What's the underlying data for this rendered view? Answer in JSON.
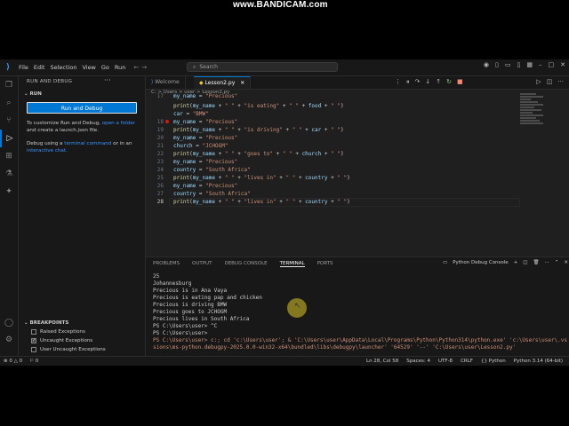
{
  "watermark": "www.BANDICAM.com",
  "menu": [
    "File",
    "Edit",
    "Selection",
    "View",
    "Go",
    "Run"
  ],
  "search": {
    "placeholder": "Search"
  },
  "tabs": [
    {
      "label": "Welcome"
    },
    {
      "label": "Lesson2.py"
    }
  ],
  "breadcrumb": "C: > Users > user > Lesson2.py",
  "sidebar": {
    "title": "RUN AND DEBUG",
    "section": "RUN",
    "run_button": "Run and Debug",
    "customize_prefix": "To customize Run and Debug,",
    "customize_link": "open a folder",
    "customize_suffix": "and create a launch.json file.",
    "terminal_prefix": "Debug using a",
    "terminal_link": "terminal command",
    "terminal_mid": "or in an",
    "chat_link": "interactive chat.",
    "breakpoints_title": "BREAKPOINTS",
    "breakpoints": [
      {
        "label": "Raised Exceptions",
        "checked": false
      },
      {
        "label": "Uncaught Exceptions",
        "checked": true
      },
      {
        "label": "User Uncaught Exceptions",
        "checked": false
      }
    ]
  },
  "code_lines": [
    {
      "n": "17",
      "text": "my_name = \"Precious\"",
      "partial": true
    },
    {
      "n": "",
      "text": "print(my_name + \" \" + \"is eating\" + \" \" + food + \" \")"
    },
    {
      "n": "",
      "text": "car = \"BMW\""
    },
    {
      "n": "18",
      "text": "my_name = \"Precious\"",
      "bp": true
    },
    {
      "n": "19",
      "text": "print(my_name + \" \" + \"is driving\" + \" \" + car + \" \")"
    },
    {
      "n": "20",
      "text": "my_name = \"Precious\""
    },
    {
      "n": "21",
      "text": "church = \"JCHOGM\""
    },
    {
      "n": "22",
      "text": "print(my_name + \" \" + \"goes to\" + \" \" + church + \" \")"
    },
    {
      "n": "23",
      "text": "my_name = \"Precious\""
    },
    {
      "n": "24",
      "text": "country = \"South Africa\""
    },
    {
      "n": "25",
      "text": "print(my_name + \" \" + \"lives in\" + \" \" + country + \" \")"
    },
    {
      "n": "26",
      "text": "my_name = \"Precious\""
    },
    {
      "n": "27",
      "text": "country = \"South Africa\""
    },
    {
      "n": "28",
      "text": "print(my_name + \" \" + \"lives in\" + \" \" + country + \" \")",
      "current": true
    }
  ],
  "panel": {
    "tabs": [
      "PROBLEMS",
      "OUTPUT",
      "DEBUG CONSOLE",
      "TERMINAL",
      "PORTS"
    ],
    "active_tab": "TERMINAL",
    "session": "Python Debug Console"
  },
  "terminal_lines": [
    "25",
    "Johannesburg",
    "Precious is in Ana Vaya",
    "Precious is eating pap and chicken",
    "Precious is driving BMW",
    "Precious goes to JCHOGM",
    "Precious lives in South Africa",
    "PS C:\\Users\\user> ^C",
    "PS C:\\Users\\user>",
    "PS C:\\Users\\user> c:; cd 'c:\\Users\\user'; & 'C:\\Users\\user\\AppData\\Local\\Programs\\Python\\Python314\\python.exe' 'c:\\Users\\user\\.vscode\\exten",
    "sions\\ms-python.debugpy-2025.0.0-win32-x64\\bundled\\libs\\debugpy\\launcher' '64529' '--' 'C:\\Users\\user\\Lesson2.py'"
  ],
  "cursor_marker": "↖",
  "status": {
    "left": [
      "⊗ 0 △ 0",
      "⚐ 0"
    ],
    "right": [
      "Ln 28, Col 58",
      "Spaces: 4",
      "UTF-8",
      "CRLF",
      "{} Python",
      "Python 3.14 (64-bit)"
    ]
  },
  "colors": {
    "accent": "#0078d4",
    "breakpoint": "#e51400",
    "string": "#ce9178",
    "function": "#dcdcaa"
  }
}
